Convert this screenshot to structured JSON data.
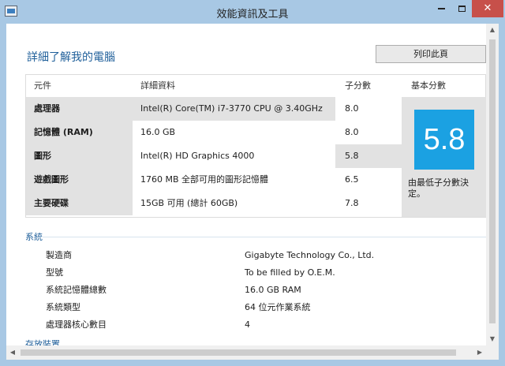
{
  "window": {
    "title": "效能資訊及工具",
    "minimize_glyph": "",
    "close_glyph": "✕"
  },
  "main": {
    "page_title": "詳細了解我的電腦",
    "print_button": "列印此頁"
  },
  "score_table": {
    "headers": {
      "component": "元件",
      "details": "詳細資料",
      "subscore": "子分數",
      "base_score": "基本分數"
    },
    "rows": [
      {
        "component": "處理器",
        "details": "Intel(R) Core(TM) i7-3770 CPU @ 3.40GHz",
        "subscore": "8.0"
      },
      {
        "component": "記憶體 (RAM)",
        "details": "16.0 GB",
        "subscore": "8.0"
      },
      {
        "component": "圖形",
        "details": "Intel(R) HD Graphics 4000",
        "subscore": "5.8"
      },
      {
        "component": "遊戲圖形",
        "details": "1760 MB 全部可用的圖形記憶體",
        "subscore": "6.5"
      },
      {
        "component": "主要硬碟",
        "details": "15GB 可用 (總計 60GB)",
        "subscore": "7.8"
      }
    ],
    "base_score": "5.8",
    "base_note": "由最低子分數決定。",
    "colors": {
      "tile": "#1ba1e2",
      "lowest_highlight": "#e2e2e2"
    }
  },
  "system": {
    "section_title": "系統",
    "items": [
      {
        "label": "製造商",
        "value": "Gigabyte Technology Co., Ltd."
      },
      {
        "label": "型號",
        "value": "To be filled by O.E.M."
      },
      {
        "label": "系統記憶體總數",
        "value": "16.0 GB RAM"
      },
      {
        "label": "系統類型",
        "value": "64 位元作業系統"
      },
      {
        "label": "處理器核心數目",
        "value": "4"
      }
    ]
  },
  "storage": {
    "section_title": "存放裝置"
  },
  "scrollbars": {
    "up": "▲",
    "down": "▼",
    "left": "◀",
    "right": "▶"
  }
}
